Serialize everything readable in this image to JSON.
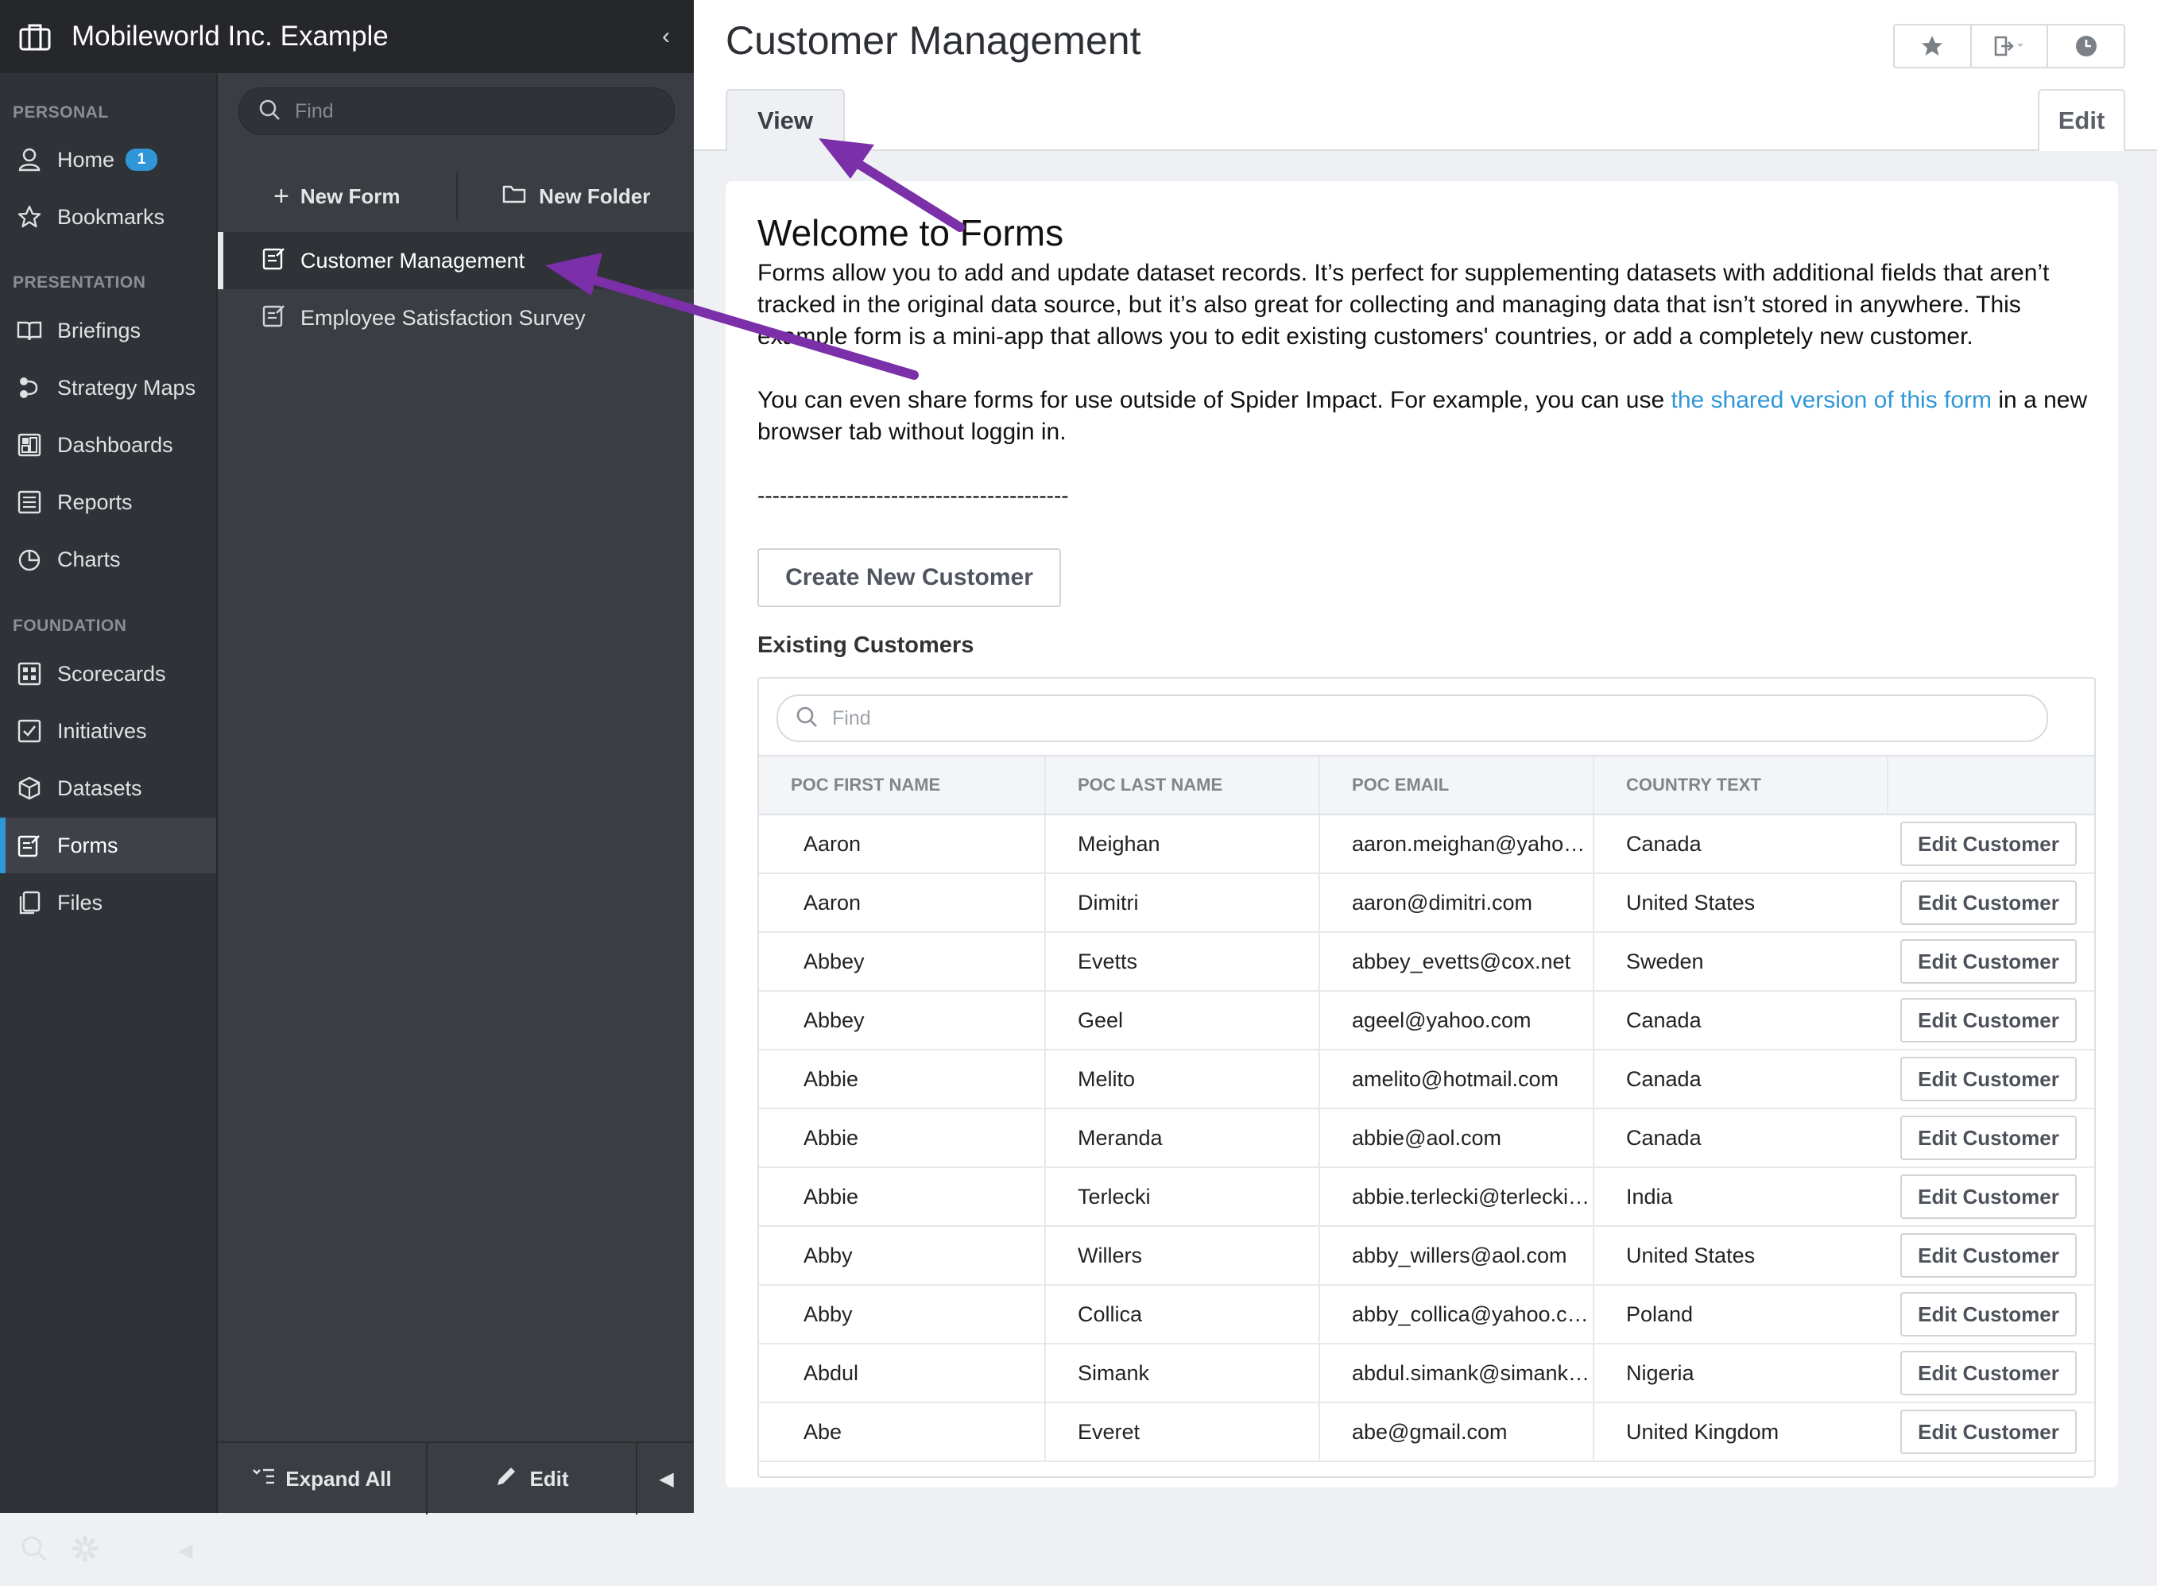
{
  "app": {
    "org_name": "Mobileworld Inc. Example"
  },
  "nav": {
    "sections": [
      {
        "label": "PERSONAL"
      },
      {
        "label": "PRESENTATION"
      },
      {
        "label": "FOUNDATION"
      }
    ],
    "items": [
      {
        "label": "Home",
        "icon": "user-icon",
        "badge": "1"
      },
      {
        "label": "Bookmarks",
        "icon": "star-icon"
      },
      {
        "label": "Briefings",
        "icon": "book-icon"
      },
      {
        "label": "Strategy Maps",
        "icon": "strategy-map-icon"
      },
      {
        "label": "Dashboards",
        "icon": "dashboard-icon"
      },
      {
        "label": "Reports",
        "icon": "report-icon"
      },
      {
        "label": "Charts",
        "icon": "pie-chart-icon"
      },
      {
        "label": "Scorecards",
        "icon": "scorecard-icon"
      },
      {
        "label": "Initiatives",
        "icon": "checkbox-icon"
      },
      {
        "label": "Datasets",
        "icon": "cube-icon"
      },
      {
        "label": "Forms",
        "icon": "form-icon",
        "active": true
      },
      {
        "label": "Files",
        "icon": "files-icon"
      }
    ]
  },
  "forms_panel": {
    "search_placeholder": "Find",
    "new_form_label": "New Form",
    "new_folder_label": "New Folder",
    "items": [
      {
        "label": "Customer Management",
        "active": true
      },
      {
        "label": "Employee Satisfaction Survey"
      }
    ],
    "expand_all_label": "Expand All",
    "edit_label": "Edit"
  },
  "main": {
    "title": "Customer Management",
    "tabs": {
      "view": "View",
      "edit": "Edit"
    },
    "welcome_title": "Welcome to Forms",
    "intro": "Forms allow you to add and update dataset records. It’s perfect for supplementing datasets with additional fields that aren’t tracked in the original data source, but it’s also great for collecting and managing data that isn’t stored in anywhere. This example form is a mini-app that allows you to edit existing customers' countries, or add a completely new customer.",
    "share_before": "You can even share forms for use outside of Spider Impact. For example, you can use ",
    "share_link": "the shared version of this form",
    "share_after": " in a new browser tab without loggin in.",
    "divider": "------------------------------------------",
    "create_button": "Create New Customer",
    "existing_label": "Existing Customers",
    "table_search_placeholder": "Find",
    "columns": [
      "POC FIRST NAME",
      "POC LAST NAME",
      "POC EMAIL",
      "COUNTRY TEXT"
    ],
    "row_action": "Edit Customer",
    "rows": [
      {
        "first": "Aaron",
        "last": "Meighan",
        "email": "aaron.meighan@yahoo.com",
        "country": "Canada"
      },
      {
        "first": "Aaron",
        "last": "Dimitri",
        "email": "aaron@dimitri.com",
        "country": "United States"
      },
      {
        "first": "Abbey",
        "last": "Evetts",
        "email": "abbey_evetts@cox.net",
        "country": "Sweden"
      },
      {
        "first": "Abbey",
        "last": "Geel",
        "email": "ageel@yahoo.com",
        "country": "Canada"
      },
      {
        "first": "Abbie",
        "last": "Melito",
        "email": "amelito@hotmail.com",
        "country": "Canada"
      },
      {
        "first": "Abbie",
        "last": "Meranda",
        "email": "abbie@aol.com",
        "country": "Canada"
      },
      {
        "first": "Abbie",
        "last": "Terlecki",
        "email": "abbie.terlecki@terlecki.com",
        "country": "India"
      },
      {
        "first": "Abby",
        "last": "Willers",
        "email": "abby_willers@aol.com",
        "country": "United States"
      },
      {
        "first": "Abby",
        "last": "Collica",
        "email": "abby_collica@yahoo.com",
        "country": "Poland"
      },
      {
        "first": "Abdul",
        "last": "Simank",
        "email": "abdul.simank@simank.com",
        "country": "Nigeria"
      },
      {
        "first": "Abe",
        "last": "Everet",
        "email": "abe@gmail.com",
        "country": "United Kingdom"
      }
    ]
  },
  "colors": {
    "accent": "#2f97d8",
    "annotation_arrow": "#7b2fa8",
    "nav_dark": "#2f3237"
  }
}
